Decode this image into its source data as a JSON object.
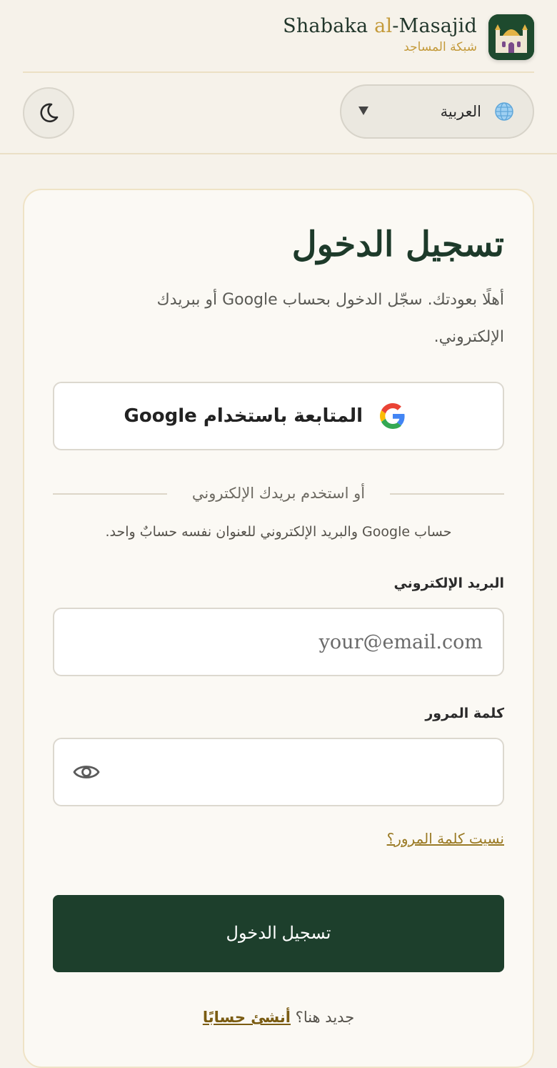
{
  "brand": {
    "name_part1": "Shabaka ",
    "name_accent": "al",
    "name_part2": "-Masajid",
    "subtitle": "شبكة المساجد",
    "logo_icon": "mosque-icon"
  },
  "toolbar": {
    "language_label": "العربية",
    "language_icon": "globe-icon",
    "theme_icon": "moon-icon"
  },
  "login": {
    "title": "تسجيل الدخول",
    "subtitle": "أهلًا بعودتك. سجّل الدخول بحساب Google أو ببريدك الإلكتروني.",
    "google_button": "المتابعة باستخدام Google",
    "divider": "أو استخدم بريدك الإلكتروني",
    "note": "حساب Google والبريد الإلكتروني للعنوان نفسه حسابٌ واحد.",
    "email_label": "البريد الإلكتروني",
    "email_placeholder": "your@email.com",
    "email_value": "",
    "password_label": "كلمة المرور",
    "password_value": "",
    "forgot_link": "نسيت كلمة المرور؟",
    "submit_button": "تسجيل الدخول",
    "signup_prompt": "جديد هنا؟",
    "signup_link": "أنشئ حسابًا"
  },
  "colors": {
    "background": "#f6f2ea",
    "primary": "#1d3f2c",
    "accent": "#c49a3a",
    "link": "#9a7a24"
  }
}
